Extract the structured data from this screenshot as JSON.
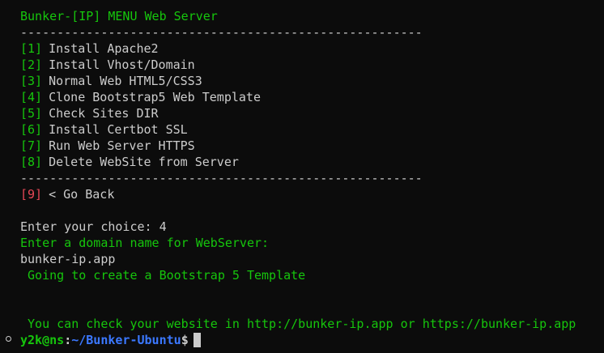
{
  "title": "Bunker-[IP] MENU Web Server",
  "separator": "-------------------------------------------------------",
  "menu": [
    {
      "num": "[1]",
      "label": "Install Apache2"
    },
    {
      "num": "[2]",
      "label": "Install Vhost/Domain"
    },
    {
      "num": "[3]",
      "label": "Normal Web HTML5/CSS3"
    },
    {
      "num": "[4]",
      "label": "Clone Bootstrap5 Web Template"
    },
    {
      "num": "[5]",
      "label": "Check Sites DIR"
    },
    {
      "num": "[6]",
      "label": "Install Certbot SSL"
    },
    {
      "num": "[7]",
      "label": "Run Web Server HTTPS"
    },
    {
      "num": "[8]",
      "label": "Delete WebSite from Server"
    }
  ],
  "back": {
    "num": "[9]",
    "label": "< Go Back"
  },
  "choice_prompt": "Enter your choice: 4",
  "domain_prompt": "Enter a domain name for WebServer:",
  "domain_value": "bunker-ip.app",
  "creating_msg": " Going to create a Bootstrap 5 Template",
  "check_msg": " You can check your website in http://bunker-ip.app or https://bunker-ip.app",
  "prompt": {
    "user_host": "y2k@ns",
    "colon": ":",
    "path": "~/Bunker-Ubuntu",
    "symbol": "$"
  },
  "colors": {
    "background": "#0c0c0c",
    "green": "#16c60c",
    "white": "#cccccc",
    "red": "#e74856",
    "blue": "#3b78ff"
  }
}
